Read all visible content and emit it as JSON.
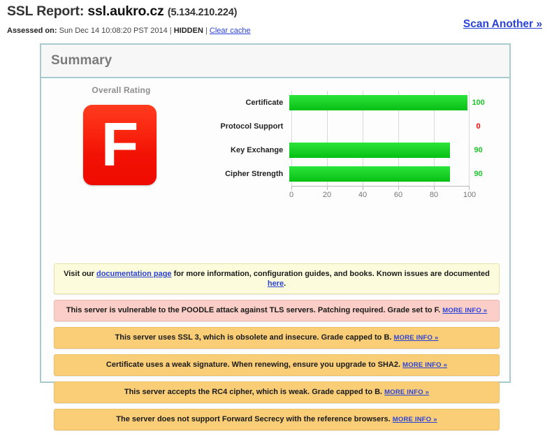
{
  "header": {
    "title_prefix": "SSL Report:",
    "hostname": "ssl.aukro.cz",
    "ip": "(5.134.210.224)",
    "assessed_label": "Assessed on:",
    "assessed_value": "Sun Dec 14 10:08:20 PST 2014",
    "sep1": "|",
    "hidden_flag": "HIDDEN",
    "sep2": "|",
    "clear_cache": "Clear cache",
    "scan_another": "Scan Another »"
  },
  "panel": {
    "title": "Summary"
  },
  "rating": {
    "caption": "Overall Rating",
    "grade": "F",
    "grade_color": "#f21204"
  },
  "chart_data": {
    "type": "bar",
    "orientation": "horizontal",
    "title": "",
    "xlabel": "",
    "ylabel": "",
    "categories": [
      "Certificate",
      "Protocol Support",
      "Key Exchange",
      "Cipher Strength"
    ],
    "values": [
      100,
      0,
      90,
      90
    ],
    "value_labels": [
      "100",
      "0",
      "90",
      "90"
    ],
    "value_colors": [
      "#1cc62a",
      "#fa0505",
      "#1cc62a",
      "#1cc62a"
    ],
    "bar_color": "#1fd52c",
    "xlim": [
      0,
      100
    ],
    "ticks": [
      0,
      20,
      40,
      60,
      80,
      100
    ],
    "tick_labels": [
      "0",
      "20",
      "40",
      "60",
      "80",
      "100"
    ],
    "grid": true,
    "legend": "none"
  },
  "notices": [
    {
      "kind": "info",
      "parts": [
        {
          "t": "Visit our ",
          "link": false
        },
        {
          "t": "documentation page",
          "link": true
        },
        {
          "t": " for more information, configuration guides, and books. Known issues are documented ",
          "link": false
        },
        {
          "t": "here",
          "link": true
        },
        {
          "t": ".",
          "link": false
        }
      ]
    },
    {
      "kind": "danger",
      "parts": [
        {
          "t": "This server is vulnerable to the POODLE attack against TLS servers. Patching required. Grade set to F. ",
          "link": false
        },
        {
          "t": "MORE INFO »",
          "link": true,
          "small": true
        }
      ]
    },
    {
      "kind": "warn",
      "parts": [
        {
          "t": "This server uses SSL 3, which is obsolete and insecure. Grade capped to B. ",
          "link": false
        },
        {
          "t": "MORE INFO »",
          "link": true,
          "small": true
        }
      ]
    },
    {
      "kind": "warn",
      "parts": [
        {
          "t": "Certificate uses a weak signature. When renewing, ensure you upgrade to SHA2.  ",
          "link": false
        },
        {
          "t": "MORE INFO »",
          "link": true,
          "small": true
        }
      ]
    },
    {
      "kind": "warn",
      "parts": [
        {
          "t": "This server accepts the RC4 cipher, which is weak. Grade capped to B.  ",
          "link": false
        },
        {
          "t": "MORE INFO »",
          "link": true,
          "small": true
        }
      ]
    },
    {
      "kind": "warn",
      "parts": [
        {
          "t": "The server does not support Forward Secrecy with the reference browsers.  ",
          "link": false
        },
        {
          "t": "MORE INFO »",
          "link": true,
          "small": true
        }
      ]
    }
  ]
}
